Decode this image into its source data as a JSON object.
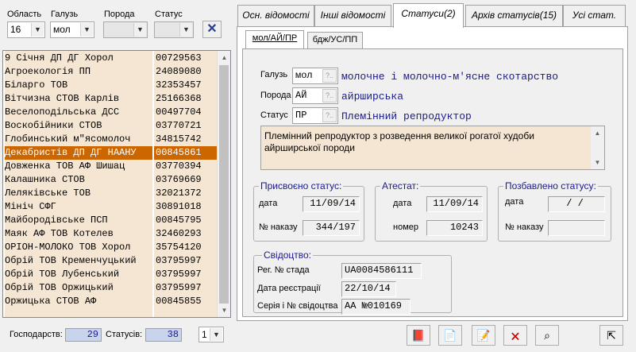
{
  "filters": {
    "region": {
      "label": "Область",
      "value": "16"
    },
    "branch": {
      "label": "Галузь",
      "value": "мол"
    },
    "breed": {
      "label": "Порода",
      "value": ""
    },
    "status": {
      "label": "Статус",
      "value": ""
    }
  },
  "farms": [
    {
      "name": "9 Січня ДП ДГ Хорол",
      "code": "00729563"
    },
    {
      "name": "Агроекологія ПП",
      "code": "24089080"
    },
    {
      "name": "Біларго ТОВ",
      "code": "32353457"
    },
    {
      "name": "Вітчизна СТОВ Карлів",
      "code": "25166368"
    },
    {
      "name": "Веселоподільська ДСС",
      "code": "00497704"
    },
    {
      "name": "Воскобійники СТОВ",
      "code": "03770721"
    },
    {
      "name": "Глобинський м\"ясомолоч",
      "code": "34815742"
    },
    {
      "name": "Декабристів ДП ДГ НААНУ",
      "code": "00845861"
    },
    {
      "name": "Довженка ТОВ АФ Шишац",
      "code": "03770394"
    },
    {
      "name": "Калашника СТОВ",
      "code": "03769669"
    },
    {
      "name": "Леляківське ТОВ",
      "code": "32021372"
    },
    {
      "name": "Мініч СФГ",
      "code": "30891018"
    },
    {
      "name": "Майбородівське ПСП",
      "code": "00845795"
    },
    {
      "name": "Маяк АФ ТОВ Котелев",
      "code": "32460293"
    },
    {
      "name": "ОРІОН-МОЛОКО ТОВ Хорол",
      "code": "35754120"
    },
    {
      "name": "Обрій ТОВ Кременчуцький",
      "code": "03795997"
    },
    {
      "name": "Обрій ТОВ Лубенський",
      "code": "03795997"
    },
    {
      "name": "Обрій ТОВ Оржицький",
      "code": "03795997"
    },
    {
      "name": "Оржицька СТОВ АФ",
      "code": "00845855"
    }
  ],
  "footer": {
    "farms_label": "Господарств:",
    "farms_count": "29",
    "statuses_label": "Статусів:",
    "statuses_count": "38",
    "page_value": "1"
  },
  "tabs": [
    "Осн. відомості",
    "Інші відомості",
    "Статуси(2)",
    "Архів статусів(15)",
    "Усі стат."
  ],
  "subtabs": [
    "мол/АЙ/ПР",
    "бдж/УС/ПП"
  ],
  "form": {
    "branch_label": "Галузь",
    "branch_code": "мол",
    "branch_desc": "молочне і молочно-м'ясне скотарство",
    "breed_label": "Порода",
    "breed_code": "АЙ",
    "breed_desc": "айрширська",
    "status_label": "Статус",
    "status_code": "ПР",
    "status_desc": "Племінний репродуктор",
    "status_full": "Племінний репродуктор з розведення великої рогатої худоби айрширської породи",
    "assigned": {
      "title": "Присвоєно статус:",
      "date_label": "дата",
      "date": "11/09/14",
      "order_label": "№ наказу",
      "order": "344/197"
    },
    "attest": {
      "title": "Атестат:",
      "date_label": "дата",
      "date": "11/09/14",
      "number_label": "номер",
      "number": "10243"
    },
    "revoked": {
      "title": "Позбавлено статусу:",
      "date_label": "дата",
      "date": "/ /",
      "order_label": "№ наказу",
      "order": ""
    },
    "certificate": {
      "title": "Свідоцтво:",
      "herd_label": "Рег. № стада",
      "herd": "UA0084586111",
      "regdate_label": "Дата реєстрації",
      "regdate": "22/10/14",
      "serial_label": "Серія і № свідоцтва",
      "serial": "АА №010169"
    }
  },
  "colors": {
    "selected_row": "#cc6600",
    "row_bg": "#f5e6d3",
    "desc_text": "#1a1a8c"
  }
}
